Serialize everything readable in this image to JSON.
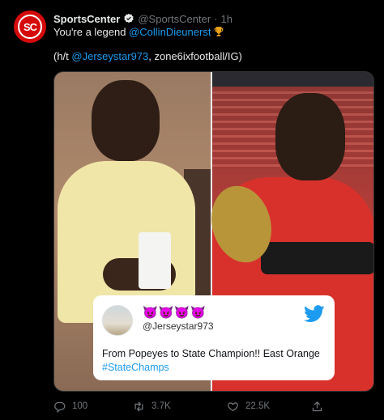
{
  "tweet": {
    "author": {
      "display_name": "SportsCenter",
      "handle": "@SportsCenter",
      "avatar_text": "SC",
      "avatar_color": "#d50a0a"
    },
    "separator": "·",
    "time": "1h",
    "line1": {
      "prefix": "You're a legend ",
      "mention": "@CollinDieunerst",
      "emoji": "trophy-icon"
    },
    "line2": {
      "prefix": "(h/t ",
      "mention": "@Jerseystar973",
      "suffix": ", zone6ixfootball/IG)"
    }
  },
  "quote_card": {
    "emojis": "😈😈😈😈",
    "handle": "@Jerseystar973",
    "text": "From Popeyes to State Champion!! East Orange ",
    "hashtag": "#StateChamps",
    "icon": "twitter-bird-icon"
  },
  "actions": {
    "reply_count": "100",
    "retweet_count": "3.7K",
    "like_count": "22.5K",
    "share_icon": "share-icon"
  },
  "colors": {
    "accent": "#1d9bf0",
    "background": "#000000",
    "muted": "#71767b"
  }
}
